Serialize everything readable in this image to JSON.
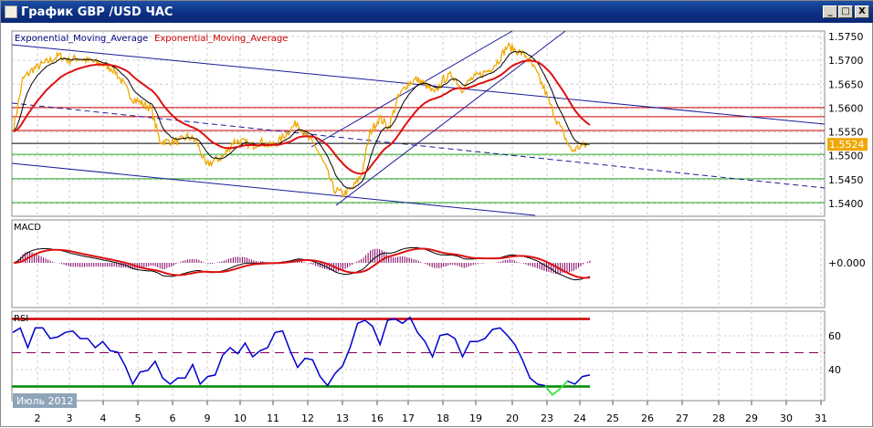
{
  "window": {
    "title": "График GBP /USD  ЧАС",
    "buttons": {
      "minimize": "_",
      "maximize": "□",
      "close": "X"
    }
  },
  "chart_data": [
    {
      "panel": "price",
      "type": "line",
      "legend": [
        {
          "name": "Exponential_Moving_Average",
          "color": "#000080"
        },
        {
          "name": "Exponential_Moving_Average",
          "color": "#cc0000"
        }
      ],
      "price_color": "#f0a800",
      "ema_fast_color": "#000000",
      "ema_slow_color": "#dd1111",
      "ylim": [
        1.5385,
        1.576
      ],
      "yticks": [
        "1.5750",
        "1.5700",
        "1.5650",
        "1.5600",
        "1.5550",
        "1.5500",
        "1.5450",
        "1.5400"
      ],
      "current_price": "1.5524",
      "current_price_color": "#f0a800",
      "close": [
        1.556,
        1.566,
        1.568,
        1.569,
        1.57,
        1.571,
        1.57,
        1.5705,
        1.57,
        1.5695,
        1.569,
        1.568,
        1.565,
        1.562,
        1.561,
        1.56,
        1.553,
        1.553,
        1.553,
        1.554,
        1.553,
        1.548,
        1.549,
        1.55,
        1.553,
        1.553,
        1.552,
        1.553,
        1.552,
        1.553,
        1.555,
        1.557,
        1.554,
        1.552,
        1.548,
        1.543,
        1.542,
        1.543,
        1.546,
        1.555,
        1.558,
        1.556,
        1.562,
        1.565,
        1.566,
        1.565,
        1.563,
        1.566,
        1.567,
        1.564,
        1.566,
        1.567,
        1.568,
        1.57,
        1.573,
        1.572,
        1.571,
        1.568,
        1.564,
        1.559,
        1.555,
        1.551,
        1.552,
        1.5524
      ],
      "horizontal_levels": [
        {
          "price": 1.5601,
          "color": "#cc0000"
        },
        {
          "price": 1.5582,
          "color": "#cc0000"
        },
        {
          "price": 1.5553,
          "color": "#cc0000"
        },
        {
          "price": 1.5526,
          "color": "#000000"
        },
        {
          "price": 1.5503,
          "color": "#22aa22"
        },
        {
          "price": 1.5452,
          "color": "#22aa22"
        },
        {
          "price": 1.5402,
          "color": "#22aa22"
        }
      ],
      "grid": true
    },
    {
      "panel": "macd",
      "type": "histogram+line",
      "label": "MACD",
      "ytick": "+0.000",
      "line_colors": [
        "#000000",
        "#dd1111"
      ],
      "hist_color": "#800060"
    },
    {
      "panel": "rsi",
      "type": "line",
      "label": "RSI",
      "ylim": [
        22,
        73
      ],
      "yticks": [
        "60",
        "40"
      ],
      "color": "#0000cc",
      "oversold_color": "#33ee33",
      "levels": [
        {
          "value": 70,
          "color": "#cc0000"
        },
        {
          "value": 50,
          "color": "#800060",
          "style": "dashed"
        },
        {
          "value": 30,
          "color": "#008800"
        }
      ],
      "values": [
        62,
        64.7,
        53,
        64.7,
        64.7,
        58.4,
        59.3,
        62,
        62.9,
        58.4,
        58.4,
        53,
        56.6,
        51.2,
        50.3,
        42.2,
        31.4,
        38.6,
        39.5,
        44.9,
        35,
        31.4,
        35,
        35,
        43,
        31.4,
        35.9,
        36.8,
        48.5,
        53,
        49.4,
        55.7,
        47.6,
        51.2,
        53,
        62,
        62.9,
        51.2,
        41.3,
        46.7,
        45.8,
        35.9,
        30.5,
        37.7,
        42.2,
        53,
        67.4,
        69.2,
        65.6,
        54.8,
        69.2,
        70.1,
        67.4,
        71,
        62,
        56.6,
        47.6,
        60.2,
        61.1,
        58.4,
        47.6,
        56.6,
        56.6,
        58.4,
        63.8,
        64.7,
        60.2,
        54.8,
        45.8,
        35,
        31.4,
        30.5,
        25,
        28.6,
        33.2,
        31.4,
        35.9,
        36.8
      ]
    },
    {
      "panel": "x-axis",
      "period_label": "Июль 2012",
      "xticks": [
        "2",
        "3",
        "4",
        "5",
        "6",
        "9",
        "10",
        "11",
        "12",
        "13",
        "16",
        "17",
        "18",
        "19",
        "20",
        "23",
        "24",
        "25",
        "26",
        "27",
        "28",
        "29",
        "30",
        "31"
      ]
    }
  ]
}
